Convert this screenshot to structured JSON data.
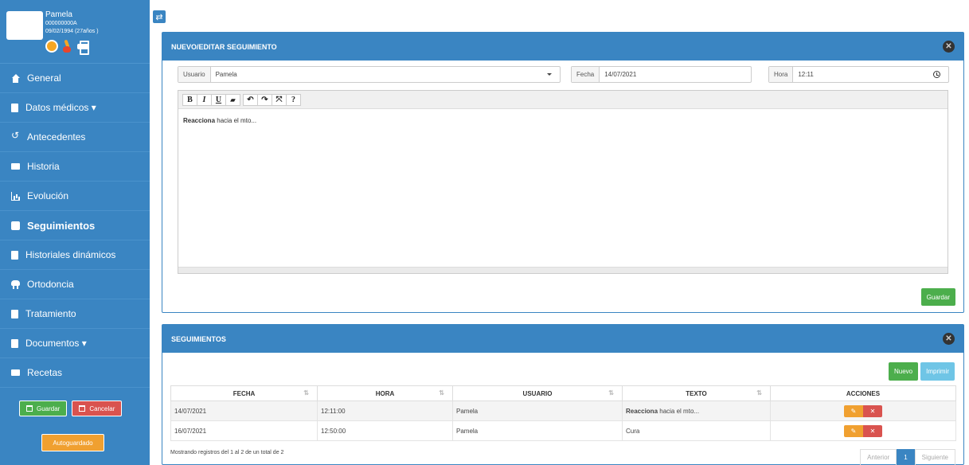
{
  "patient": {
    "name": "Pamela",
    "id": "000000000A",
    "dob": "09/02/1994 (27años )"
  },
  "sidebar": {
    "items": [
      {
        "label": "General",
        "icon": "home-icon"
      },
      {
        "label": "Datos médicos ▾",
        "icon": "clipboard-icon"
      },
      {
        "label": "Antecedentes",
        "icon": "history-icon"
      },
      {
        "label": "Historia",
        "icon": "card-icon"
      },
      {
        "label": "Evolución",
        "icon": "bar-chart-icon"
      },
      {
        "label": "Seguimientos",
        "icon": "calendar-box-icon"
      },
      {
        "label": "Historiales dinámicos",
        "icon": "document-icon"
      },
      {
        "label": "Ortodoncia",
        "icon": "tooth-icon"
      },
      {
        "label": "Tratamiento",
        "icon": "document-plus-icon"
      },
      {
        "label": "Documentos ▾",
        "icon": "file-icon"
      },
      {
        "label": "Recetas",
        "icon": "list-icon"
      }
    ],
    "save_label": "Guardar",
    "cancel_label": "Cancelar",
    "autosave_label": "Autoguardado"
  },
  "editor_panel": {
    "title": "NUEVO/EDITAR SEGUIMIENTO",
    "user_label": "Usuario",
    "user_value": "Pamela",
    "date_label": "Fecha",
    "date_value": "14/07/2021",
    "time_label": "Hora",
    "time_value": "12:11",
    "toolbar": [
      "B",
      "I",
      "U",
      "▰",
      "↶",
      "↷",
      "⤧",
      "?"
    ],
    "content_bold": "Reacciona",
    "content_rest": " hacia el mto...",
    "save_label": "Guardar"
  },
  "list_panel": {
    "title": "SEGUIMIENTOS",
    "new_label": "Nuevo",
    "print_label": "Imprimir",
    "columns": [
      "FECHA",
      "HORA",
      "USUARIO",
      "TEXTO",
      "ACCIONES"
    ],
    "rows": [
      {
        "fecha": "14/07/2021",
        "hora": "12:11:00",
        "usuario": "Pamela",
        "texto_bold": "Reacciona",
        "texto_rest": " hacia el mto..."
      },
      {
        "fecha": "16/07/2021",
        "hora": "12:50:00",
        "usuario": "Pamela",
        "texto_bold": "",
        "texto_rest": "Cura"
      }
    ],
    "info": "Mostrando registros del 1 al 2 de un total de 2",
    "prev_label": "Anterior",
    "page": "1",
    "next_label": "Siguiente"
  },
  "colors": {
    "primary": "#3a85c2",
    "success": "#4cae4c",
    "danger": "#d9534f",
    "warning": "#f0a030",
    "info": "#6fc5e6"
  }
}
